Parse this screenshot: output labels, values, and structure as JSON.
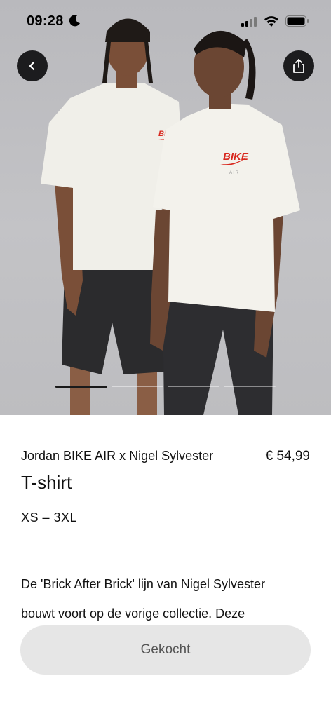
{
  "status_bar": {
    "time": "09:28"
  },
  "nav": {
    "back_icon": "chevron-left-icon",
    "share_icon": "share-icon"
  },
  "carousel": {
    "total": 4,
    "active_index": 0
  },
  "product": {
    "brand_line": "Jordan BIKE AIR x Nigel Sylvester",
    "price": "€ 54,99",
    "title": "T-shirt",
    "sizes": "XS – 3XL",
    "description_lines": [
      "De 'Brick After Brick' lijn van Nigel Sylvester",
      "bouwt voort op de vorige collectie. Deze"
    ]
  },
  "cta": {
    "label": "Gekocht"
  },
  "colors": {
    "logo_red": "#d8281e",
    "button_dark": "#1c1c1e",
    "cta_bg": "#e6e6e6"
  }
}
